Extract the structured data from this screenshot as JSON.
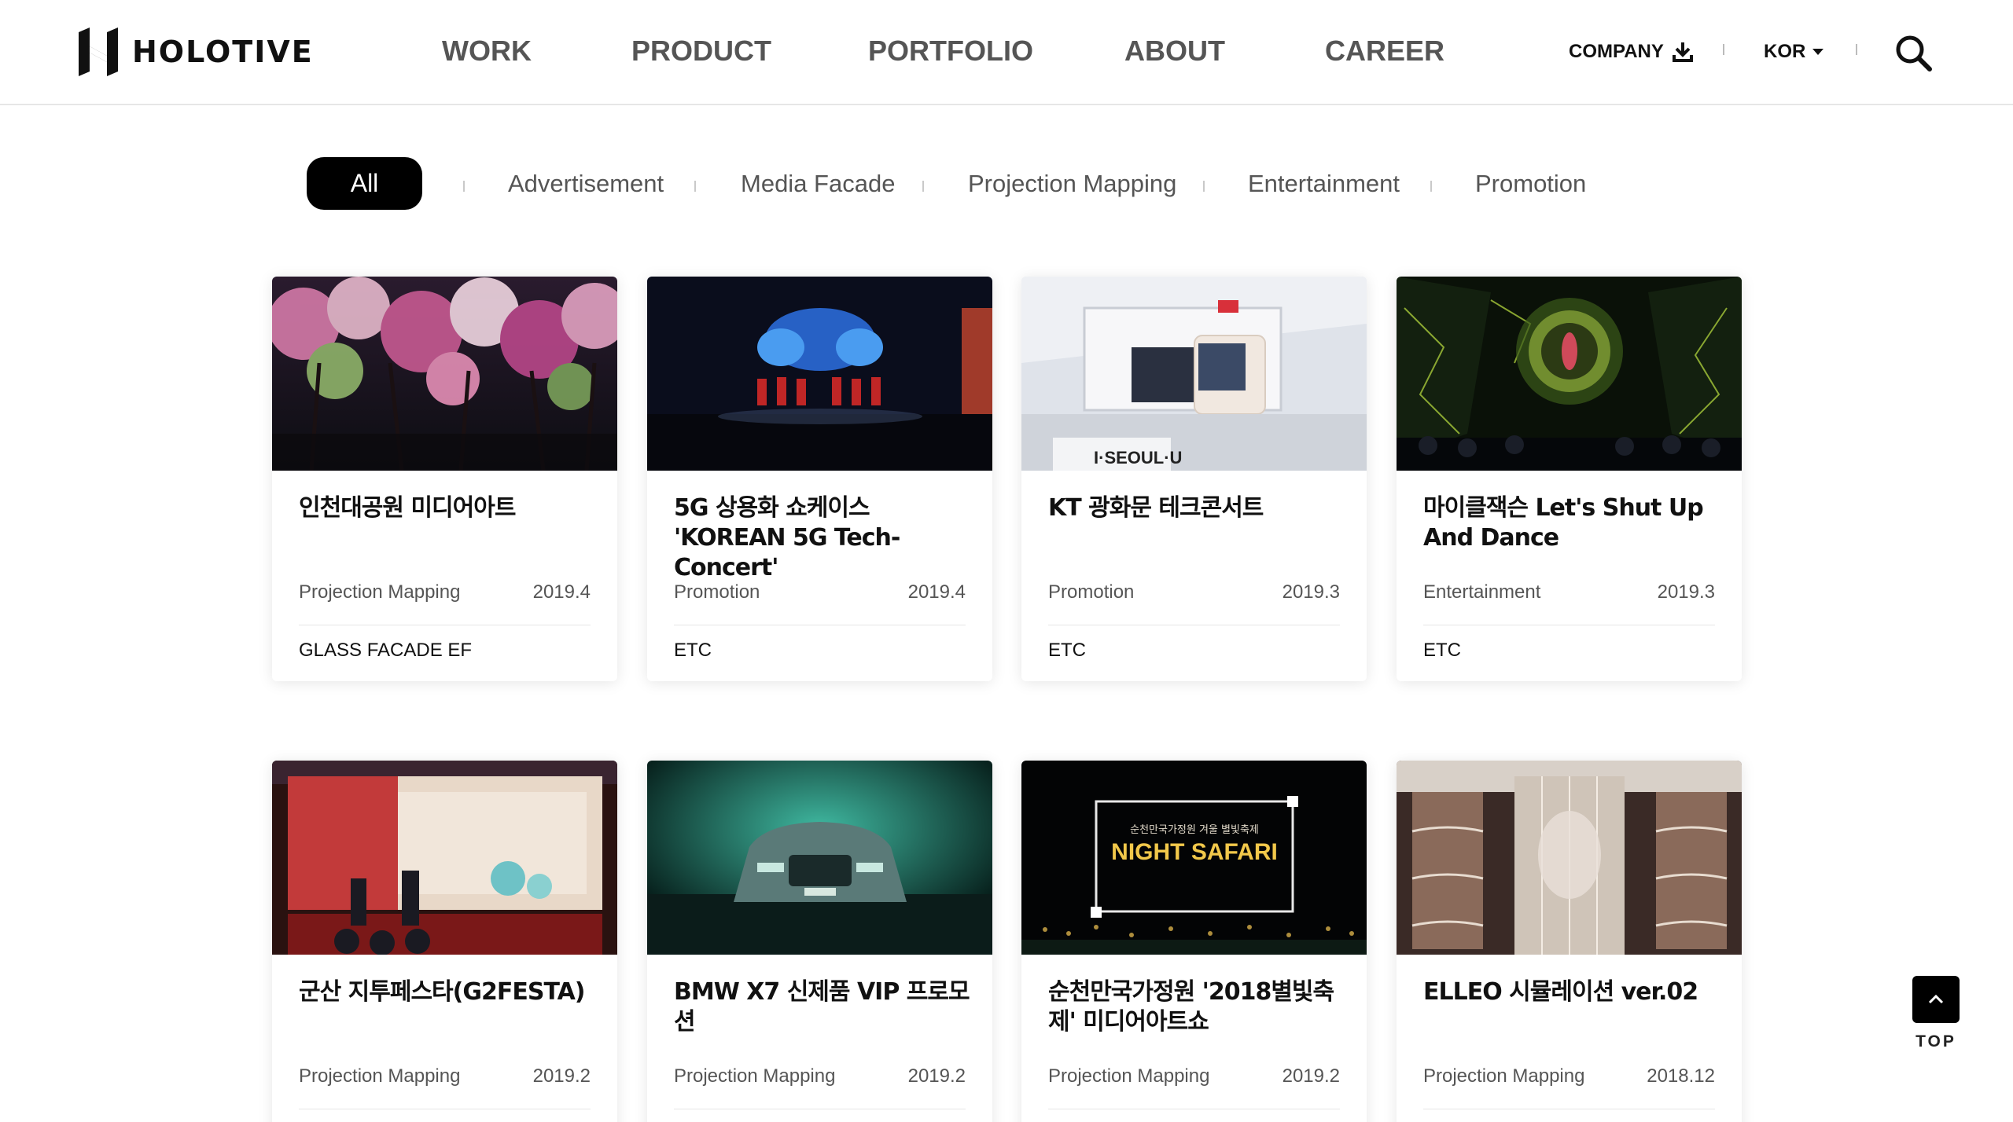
{
  "brand": {
    "name": "HOLOTIVE"
  },
  "nav": {
    "items": [
      "WORK",
      "PRODUCT",
      "PORTFOLIO",
      "ABOUT",
      "CAREER"
    ]
  },
  "utility": {
    "company_label": "COMPANY",
    "language_label": "KOR"
  },
  "filters": {
    "active": "All",
    "items": [
      "Advertisement",
      "Media Facade",
      "Projection Mapping",
      "Entertainment",
      "Promotion"
    ]
  },
  "cards": [
    {
      "title": "인천대공원 미디어아트",
      "category": "Projection Mapping",
      "date": "2019.4",
      "client": "GLASS FACADE EF"
    },
    {
      "title": "5G 상용화 쇼케이스 'KOREAN 5G Tech-Concert'",
      "category": "Promotion",
      "date": "2019.4",
      "client": "ETC"
    },
    {
      "title": "KT 광화문 테크콘서트",
      "category": "Promotion",
      "date": "2019.3",
      "client": "ETC"
    },
    {
      "title": "마이클잭슨 Let's Shut Up And Dance",
      "category": "Entertainment",
      "date": "2019.3",
      "client": "ETC"
    },
    {
      "title": "군산 지투페스타(G2FESTA)",
      "category": "Projection Mapping",
      "date": "2019.2",
      "client": ""
    },
    {
      "title": "BMW X7 신제품 VIP 프로모션",
      "category": "Projection Mapping",
      "date": "2019.2",
      "client": ""
    },
    {
      "title": "순천만국가정원 '2018별빛축제' 미디어아트쇼",
      "category": "Projection Mapping",
      "date": "2019.2",
      "client": ""
    },
    {
      "title": "ELLEO 시뮬레이션 ver.02",
      "category": "Projection Mapping",
      "date": "2018.12",
      "client": ""
    }
  ],
  "thumb_text": {
    "kt_sign": "I·SEOUL·U",
    "night_small": "순천만국가정원 겨울 별빛축제",
    "night_title": "NIGHT SAFARI"
  },
  "top_button": {
    "label": "TOP"
  },
  "colors": {
    "accent": "#000000",
    "text": "#111111",
    "muted": "#555555"
  },
  "icons": [
    "download-icon",
    "caret-down-icon",
    "search-icon",
    "chevron-up-icon"
  ]
}
